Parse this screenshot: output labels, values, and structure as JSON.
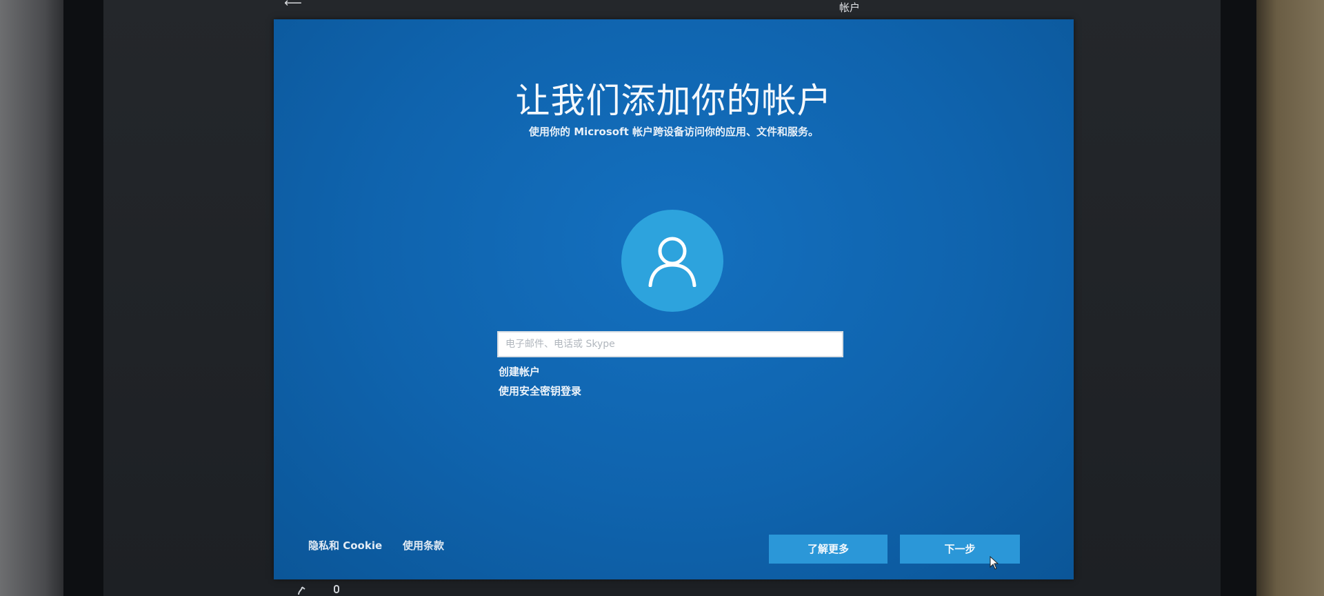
{
  "window": {
    "tab_label": "帐户"
  },
  "page": {
    "title": "让我们添加你的帐户",
    "subtitle": "使用你的 Microsoft 帐户跨设备访问你的应用、文件和服务。"
  },
  "account_input": {
    "placeholder": "电子邮件、电话或 Skype",
    "value": ""
  },
  "links": {
    "create_account": "创建帐户",
    "security_key": "使用安全密钥登录"
  },
  "footer": {
    "privacy": "隐私和 Cookie",
    "terms": "使用条款"
  },
  "buttons": {
    "learn_more": "了解更多",
    "next": "下一步"
  },
  "colors": {
    "dialog_blue": "#1068b3",
    "avatar_circle": "#2da3dd",
    "button_blue": "#2b97d8"
  },
  "icons": {
    "avatar": "user-silhouette-icon",
    "back": "back-arrow-icon",
    "cursor": "mouse-pointer-icon"
  }
}
